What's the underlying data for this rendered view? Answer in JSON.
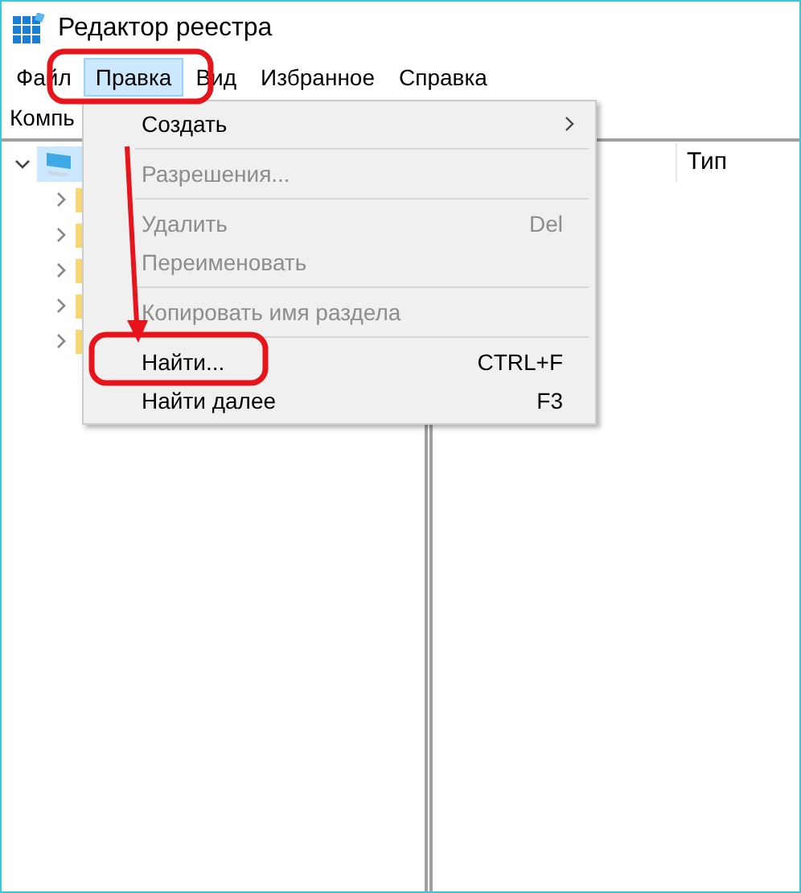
{
  "window": {
    "title": "Редактор реестра"
  },
  "menu_bar": [
    {
      "label": "Файл",
      "selected": false
    },
    {
      "label": "Правка",
      "selected": true
    },
    {
      "label": "Вид",
      "selected": false
    },
    {
      "label": "Избранное",
      "selected": false
    },
    {
      "label": "Справка",
      "selected": false
    }
  ],
  "address_bar": {
    "value": "Компь"
  },
  "tree": [
    {
      "kind": "computer",
      "expanded": true,
      "selected": true,
      "children": [
        {
          "kind": "folder",
          "expanded": false,
          "selected": false
        },
        {
          "kind": "folder",
          "expanded": false,
          "selected": false
        },
        {
          "kind": "folder",
          "expanded": false,
          "selected": false
        },
        {
          "kind": "folder",
          "expanded": false,
          "selected": false
        },
        {
          "kind": "folder",
          "expanded": false,
          "selected": false
        }
      ]
    }
  ],
  "table": {
    "columns": [
      "Тип"
    ]
  },
  "dropdown_menu": [
    {
      "kind": "item",
      "label": "Создать",
      "disabled": false,
      "submenu": true
    },
    {
      "kind": "separator"
    },
    {
      "kind": "item",
      "label": "Разрешения...",
      "disabled": true,
      "submenu": false
    },
    {
      "kind": "separator"
    },
    {
      "kind": "item",
      "label": "Удалить",
      "shortcut": "Del",
      "disabled": true,
      "submenu": false
    },
    {
      "kind": "item",
      "label": "Переименовать",
      "disabled": true,
      "submenu": false
    },
    {
      "kind": "separator"
    },
    {
      "kind": "item",
      "label": "Копировать имя раздела",
      "disabled": true,
      "submenu": false
    },
    {
      "kind": "separator"
    },
    {
      "kind": "item",
      "label": "Найти...",
      "shortcut": "CTRL+F",
      "disabled": false,
      "submenu": false
    },
    {
      "kind": "item",
      "label": "Найти далее",
      "shortcut": "F3",
      "disabled": false,
      "submenu": false
    }
  ]
}
